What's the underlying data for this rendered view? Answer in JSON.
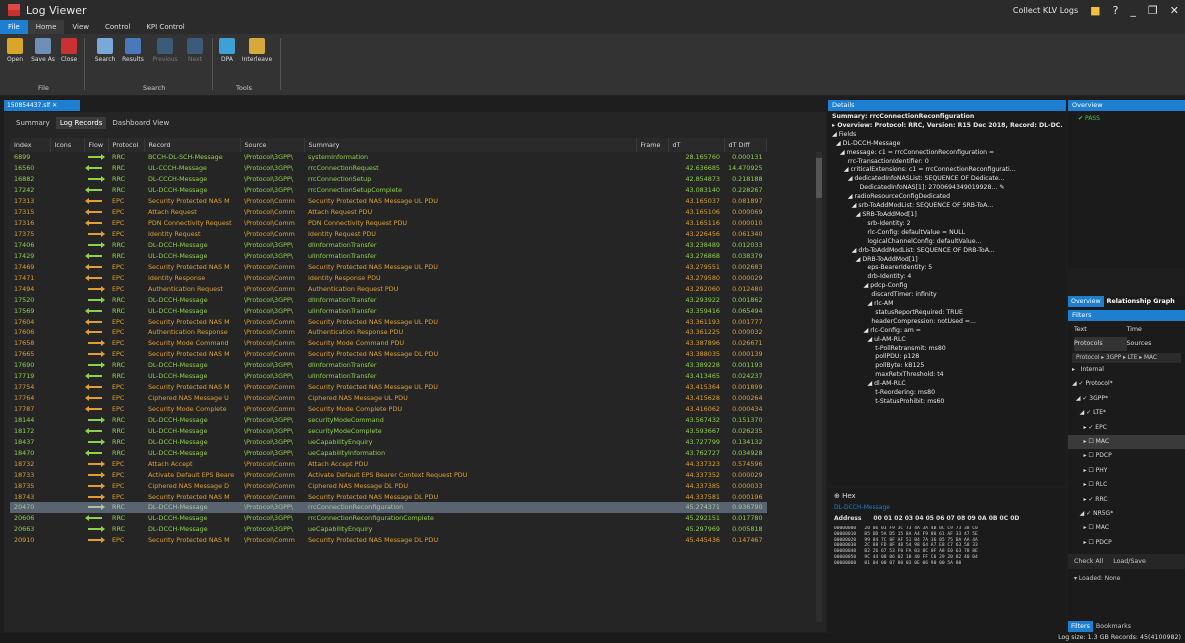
{
  "app": {
    "title": "Log Viewer",
    "collect": "Collect KLV Logs"
  },
  "menu": [
    "File",
    "Home",
    "View",
    "Control",
    "KPI Control"
  ],
  "ribbon": {
    "buttons": [
      "Open",
      "Save As",
      "Close",
      "Search",
      "Results",
      "Previous",
      "Next",
      "DPA",
      "Interleave"
    ],
    "groups": [
      "File",
      "Search",
      "Tools"
    ]
  },
  "doc_tab": "150854437.slf",
  "subtabs": [
    "Summary",
    "Log Records",
    "Dashboard View"
  ],
  "columns": [
    "Index",
    "Icons",
    "Flow",
    "Protocol",
    "Record",
    "Source",
    "Summary",
    "Frame",
    "dT",
    "dT Diff"
  ],
  "rows": [
    {
      "i": "6899",
      "f": "r",
      "p": "RRC",
      "r": "BCCH-DL-SCH-Message",
      "s": "\\Protocol\\3GPP\\",
      "m": "systemInformation",
      "dt": "28.165760",
      "dd": "0.000131"
    },
    {
      "i": "16560",
      "f": "l",
      "p": "RRC",
      "r": "UL-CCCH-Message",
      "s": "\\Protocol\\3GPP\\",
      "m": "rrcConnectionRequest",
      "dt": "42.636685",
      "dd": "14.470925"
    },
    {
      "i": "16882",
      "f": "r",
      "p": "RRC",
      "r": "DL-CCCH-Message",
      "s": "\\Protocol\\3GPP\\",
      "m": "rrcConnectionSetup",
      "dt": "42.854873",
      "dd": "0.218188"
    },
    {
      "i": "17242",
      "f": "l",
      "p": "RRC",
      "r": "UL-DCCH-Message",
      "s": "\\Protocol\\3GPP\\",
      "m": "rrcConnectionSetupComplete",
      "dt": "43.083140",
      "dd": "0.228267"
    },
    {
      "i": "17313",
      "f": "l",
      "p": "EPC",
      "r": "Security Protected NAS M",
      "s": "\\Protocol\\Comm",
      "m": "Security Protected NAS Message UL PDU",
      "dt": "43.165037",
      "dd": "0.081897"
    },
    {
      "i": "17315",
      "f": "l",
      "p": "EPC",
      "r": "Attach Request",
      "s": "\\Protocol\\Comm",
      "m": "Attach Request PDU",
      "dt": "43.165106",
      "dd": "0.000069"
    },
    {
      "i": "17316",
      "f": "l",
      "p": "EPC",
      "r": "PDN Connectivity Request",
      "s": "\\Protocol\\Comm",
      "m": "PDN Connectivity Request PDU",
      "dt": "43.165116",
      "dd": "0.000010"
    },
    {
      "i": "17375",
      "f": "r",
      "p": "EPC",
      "r": "Identity Request",
      "s": "\\Protocol\\Comm",
      "m": "Identity Request PDU",
      "dt": "43.226456",
      "dd": "0.061340"
    },
    {
      "i": "17406",
      "f": "r",
      "p": "RRC",
      "r": "DL-DCCH-Message",
      "s": "\\Protocol\\3GPP\\",
      "m": "dlInformationTransfer",
      "dt": "43.238489",
      "dd": "0.012033"
    },
    {
      "i": "17429",
      "f": "l",
      "p": "RRC",
      "r": "UL-DCCH-Message",
      "s": "\\Protocol\\3GPP\\",
      "m": "ulInformationTransfer",
      "dt": "43.276868",
      "dd": "0.038379"
    },
    {
      "i": "17469",
      "f": "l",
      "p": "EPC",
      "r": "Security Protected NAS M",
      "s": "\\Protocol\\Comm",
      "m": "Security Protected NAS Message UL PDU",
      "dt": "43.279551",
      "dd": "0.002683"
    },
    {
      "i": "17471",
      "f": "l",
      "p": "EPC",
      "r": "Identity Response",
      "s": "\\Protocol\\Comm",
      "m": "Identity Response PDU",
      "dt": "43.279580",
      "dd": "0.000029"
    },
    {
      "i": "17494",
      "f": "r",
      "p": "EPC",
      "r": "Authentication Request",
      "s": "\\Protocol\\Comm",
      "m": "Authentication Request PDU",
      "dt": "43.292060",
      "dd": "0.012480"
    },
    {
      "i": "17520",
      "f": "r",
      "p": "RRC",
      "r": "DL-DCCH-Message",
      "s": "\\Protocol\\3GPP\\",
      "m": "dlInformationTransfer",
      "dt": "43.293922",
      "dd": "0.001862"
    },
    {
      "i": "17569",
      "f": "l",
      "p": "RRC",
      "r": "UL-DCCH-Message",
      "s": "\\Protocol\\3GPP\\",
      "m": "ulInformationTransfer",
      "dt": "43.359416",
      "dd": "0.065494"
    },
    {
      "i": "17604",
      "f": "l",
      "p": "EPC",
      "r": "Security Protected NAS M",
      "s": "\\Protocol\\Comm",
      "m": "Security Protected NAS Message UL PDU",
      "dt": "43.361193",
      "dd": "0.001777"
    },
    {
      "i": "17606",
      "f": "l",
      "p": "EPC",
      "r": "Authentication Response",
      "s": "\\Protocol\\Comm",
      "m": "Authentication Response PDU",
      "dt": "43.361225",
      "dd": "0.000032"
    },
    {
      "i": "17658",
      "f": "r",
      "p": "EPC",
      "r": "Security Mode Command",
      "s": "\\Protocol\\Comm",
      "m": "Security Mode Command PDU",
      "dt": "43.387896",
      "dd": "0.026671"
    },
    {
      "i": "17665",
      "f": "r",
      "p": "EPC",
      "r": "Security Protected NAS M",
      "s": "\\Protocol\\Comm",
      "m": "Security Protected NAS Message DL PDU",
      "dt": "43.388035",
      "dd": "0.000139"
    },
    {
      "i": "17690",
      "f": "r",
      "p": "RRC",
      "r": "DL-DCCH-Message",
      "s": "\\Protocol\\3GPP\\",
      "m": "dlInformationTransfer",
      "dt": "43.389228",
      "dd": "0.001193"
    },
    {
      "i": "17719",
      "f": "l",
      "p": "RRC",
      "r": "UL-DCCH-Message",
      "s": "\\Protocol\\3GPP\\",
      "m": "ulInformationTransfer",
      "dt": "43.413465",
      "dd": "0.024237"
    },
    {
      "i": "17754",
      "f": "l",
      "p": "EPC",
      "r": "Security Protected NAS M",
      "s": "\\Protocol\\Comm",
      "m": "Security Protected NAS Message UL PDU",
      "dt": "43.415364",
      "dd": "0.001899"
    },
    {
      "i": "17764",
      "f": "l",
      "p": "EPC",
      "r": "Ciphered NAS Message U",
      "s": "\\Protocol\\Comm",
      "m": "Ciphered NAS Message UL PDU",
      "dt": "43.415628",
      "dd": "0.000264"
    },
    {
      "i": "17787",
      "f": "l",
      "p": "EPC",
      "r": "Security Mode Complete",
      "s": "\\Protocol\\Comm",
      "m": "Security Mode Complete PDU",
      "dt": "43.416062",
      "dd": "0.000434"
    },
    {
      "i": "18144",
      "f": "r",
      "p": "RRC",
      "r": "DL-DCCH-Message",
      "s": "\\Protocol\\3GPP\\",
      "m": "securityModeCommand",
      "dt": "43.567432",
      "dd": "0.151370"
    },
    {
      "i": "18172",
      "f": "l",
      "p": "RRC",
      "r": "UL-DCCH-Message",
      "s": "\\Protocol\\3GPP\\",
      "m": "securityModeComplete",
      "dt": "43.593667",
      "dd": "0.026235"
    },
    {
      "i": "18437",
      "f": "r",
      "p": "RRC",
      "r": "DL-DCCH-Message",
      "s": "\\Protocol\\3GPP\\",
      "m": "ueCapabilityEnquiry",
      "dt": "43.727799",
      "dd": "0.134132"
    },
    {
      "i": "18470",
      "f": "l",
      "p": "RRC",
      "r": "UL-DCCH-Message",
      "s": "\\Protocol\\3GPP\\",
      "m": "ueCapabilityInformation",
      "dt": "43.762727",
      "dd": "0.034928"
    },
    {
      "i": "18732",
      "f": "r",
      "p": "EPC",
      "r": "Attach Accept",
      "s": "\\Protocol\\Comm",
      "m": "Attach Accept PDU",
      "dt": "44.337323",
      "dd": "0.574596"
    },
    {
      "i": "18733",
      "f": "r",
      "p": "EPC",
      "r": "Activate Default EPS Beare",
      "s": "\\Protocol\\Comm",
      "m": "Activate Default EPS Bearer Context Request PDU",
      "dt": "44.337352",
      "dd": "0.000029"
    },
    {
      "i": "18735",
      "f": "r",
      "p": "EPC",
      "r": "Ciphered NAS Message D",
      "s": "\\Protocol\\Comm",
      "m": "Ciphered NAS Message DL PDU",
      "dt": "44.337385",
      "dd": "0.000033"
    },
    {
      "i": "18743",
      "f": "r",
      "p": "EPC",
      "r": "Security Protected NAS M",
      "s": "\\Protocol\\Comm",
      "m": "Security Protected NAS Message DL PDU",
      "dt": "44.337581",
      "dd": "0.000196"
    },
    {
      "i": "20470",
      "f": "r",
      "p": "RRC",
      "r": "DL-DCCH-Message",
      "s": "\\Protocol\\3GPP\\",
      "m": "rrcConnectionReconfiguration",
      "dt": "45.274371",
      "dd": "0.936790",
      "sel": true
    },
    {
      "i": "20606",
      "f": "l",
      "p": "RRC",
      "r": "UL-DCCH-Message",
      "s": "\\Protocol\\3GPP\\",
      "m": "rrcConnectionReconfigurationComplete",
      "dt": "45.292151",
      "dd": "0.017780"
    },
    {
      "i": "20663",
      "f": "r",
      "p": "RRC",
      "r": "DL-DCCH-Message",
      "s": "\\Protocol\\3GPP\\",
      "m": "ueCapabilityEnquiry",
      "dt": "45.297969",
      "dd": "0.005818"
    },
    {
      "i": "20910",
      "f": "r",
      "p": "EPC",
      "r": "Security Protected NAS M",
      "s": "\\Protocol\\Comm",
      "m": "Security Protected NAS Message DL PDU",
      "dt": "45.445436",
      "dd": "0.147467"
    }
  ],
  "details": {
    "title": "Details",
    "lines": [
      "Summary: rrcConnectionReconfiguration",
      "▸ Overview: Protocol: RRC, Version: R15 Dec 2018, Record: DL-DC...",
      "◢ Fields",
      "  ◢ DL-DCCH-Message",
      "    ◢ message: c1 = rrcConnectionReconfiguration =",
      "        rrc-TransactionIdentifier: 0",
      "      ◢ criticalExtensions: c1 = rrcConnectionReconfigurati...",
      "        ◢ dedicatedInfoNASList: SEQUENCE OF Dedicate...",
      "              DedicatedInfoNAS[1]: 2700694349019928... ✎",
      "        ◢ radioResourceConfigDedicated",
      "          ◢ srb-ToAddModList: SEQUENCE OF SRB-ToA...",
      "            ◢ SRB-ToAddMod[1]",
      "                  srb-Identity: 2",
      "                  rlc-Config: defaultValue = NULL",
      "                  logicalChannelConfig: defaultValue...",
      "          ◢ drb-ToAddModList: SEQUENCE OF DRB-ToA...",
      "            ◢ DRB-ToAddMod[1]",
      "                  eps-BearerIdentity: 5",
      "                  drb-Identity: 4",
      "                ◢ pdcp-Config",
      "                    discardTimer: infinity",
      "                  ◢ rlc-AM",
      "                      statusReportRequired: TRUE",
      "                    headerCompression: notUsed =...",
      "                ◢ rlc-Config: am =",
      "                  ◢ ul-AM-RLC",
      "                      t-PollRetransmit: ms80",
      "                      pollPDU: p128",
      "                      pollByte: kB125",
      "                      maxRetxThreshold: t4",
      "                  ◢ dl-AM-RLC",
      "                      t-Reordering: ms80",
      "                      t-StatusProhibit: ms60"
    ]
  },
  "hex": {
    "title": "Hex",
    "sub": "DL-DCCH-Message",
    "addr_label": "Address",
    "header": "00 01 02 03 04 05 06 07 08 09 0A 0B 0C 0D",
    "rows": [
      "00000000   20 06 03 F9 3C 73 4A 3A 4B 0C C9 73 38 C0",
      "00000010   B5 DD 5A D5 15 8A A4 F9 80 61 AF 33 47 5E",
      "00000020   99 84 7C 8F AF 51 84 7A 36 05 75 BA AA 4A",
      "00000030   2C 88 FD 8F 48 54 98 64 A7 E8 C7 63 58 33",
      "00000040   B2 26 67 53 F0 FA 03 8C 0F A8 E0 63 78 8E",
      "00000050   9C 44 00 06 02 10 40 FF C0 29 20 82 40 04",
      "00000060   01 04 00 07 80 03 0E 06 90 00 5A 80"
    ]
  },
  "overview": {
    "title": "Overview",
    "pass": "PASS"
  },
  "right_tabs": [
    "Overview",
    "Relationship Graph"
  ],
  "filters": {
    "title": "Filters",
    "grid": [
      "Text",
      "Time",
      "Protocols",
      "Sources"
    ],
    "chips": [
      "Protocol ▸ 3GPP ▸ LTE ▸ MAC"
    ],
    "tree": [
      "▸   Internal",
      "◢ ✓ Protocol*",
      "  ◢ ✓ 3GPP*",
      "    ◢ ✓ LTE*",
      "      ▸ ✓ EPC",
      "      ▸ ☐ MAC",
      "      ▸ ☐ PDCP",
      "      ▸ ☐ PHY",
      "      ▸ ☐ RLC",
      "      ▸ ✓ RRC",
      "    ◢ ✓ NR5G*",
      "      ▸ ☐ MAC",
      "      ▸ ☐ PDCP"
    ],
    "buttons": [
      "Check All",
      "Load/Save"
    ],
    "loaded": "▾ Loaded: None",
    "bottom_tabs": [
      "Filters",
      "Bookmarks"
    ]
  },
  "status": "Log size: 1.3 GB Records: 45(4100982)"
}
